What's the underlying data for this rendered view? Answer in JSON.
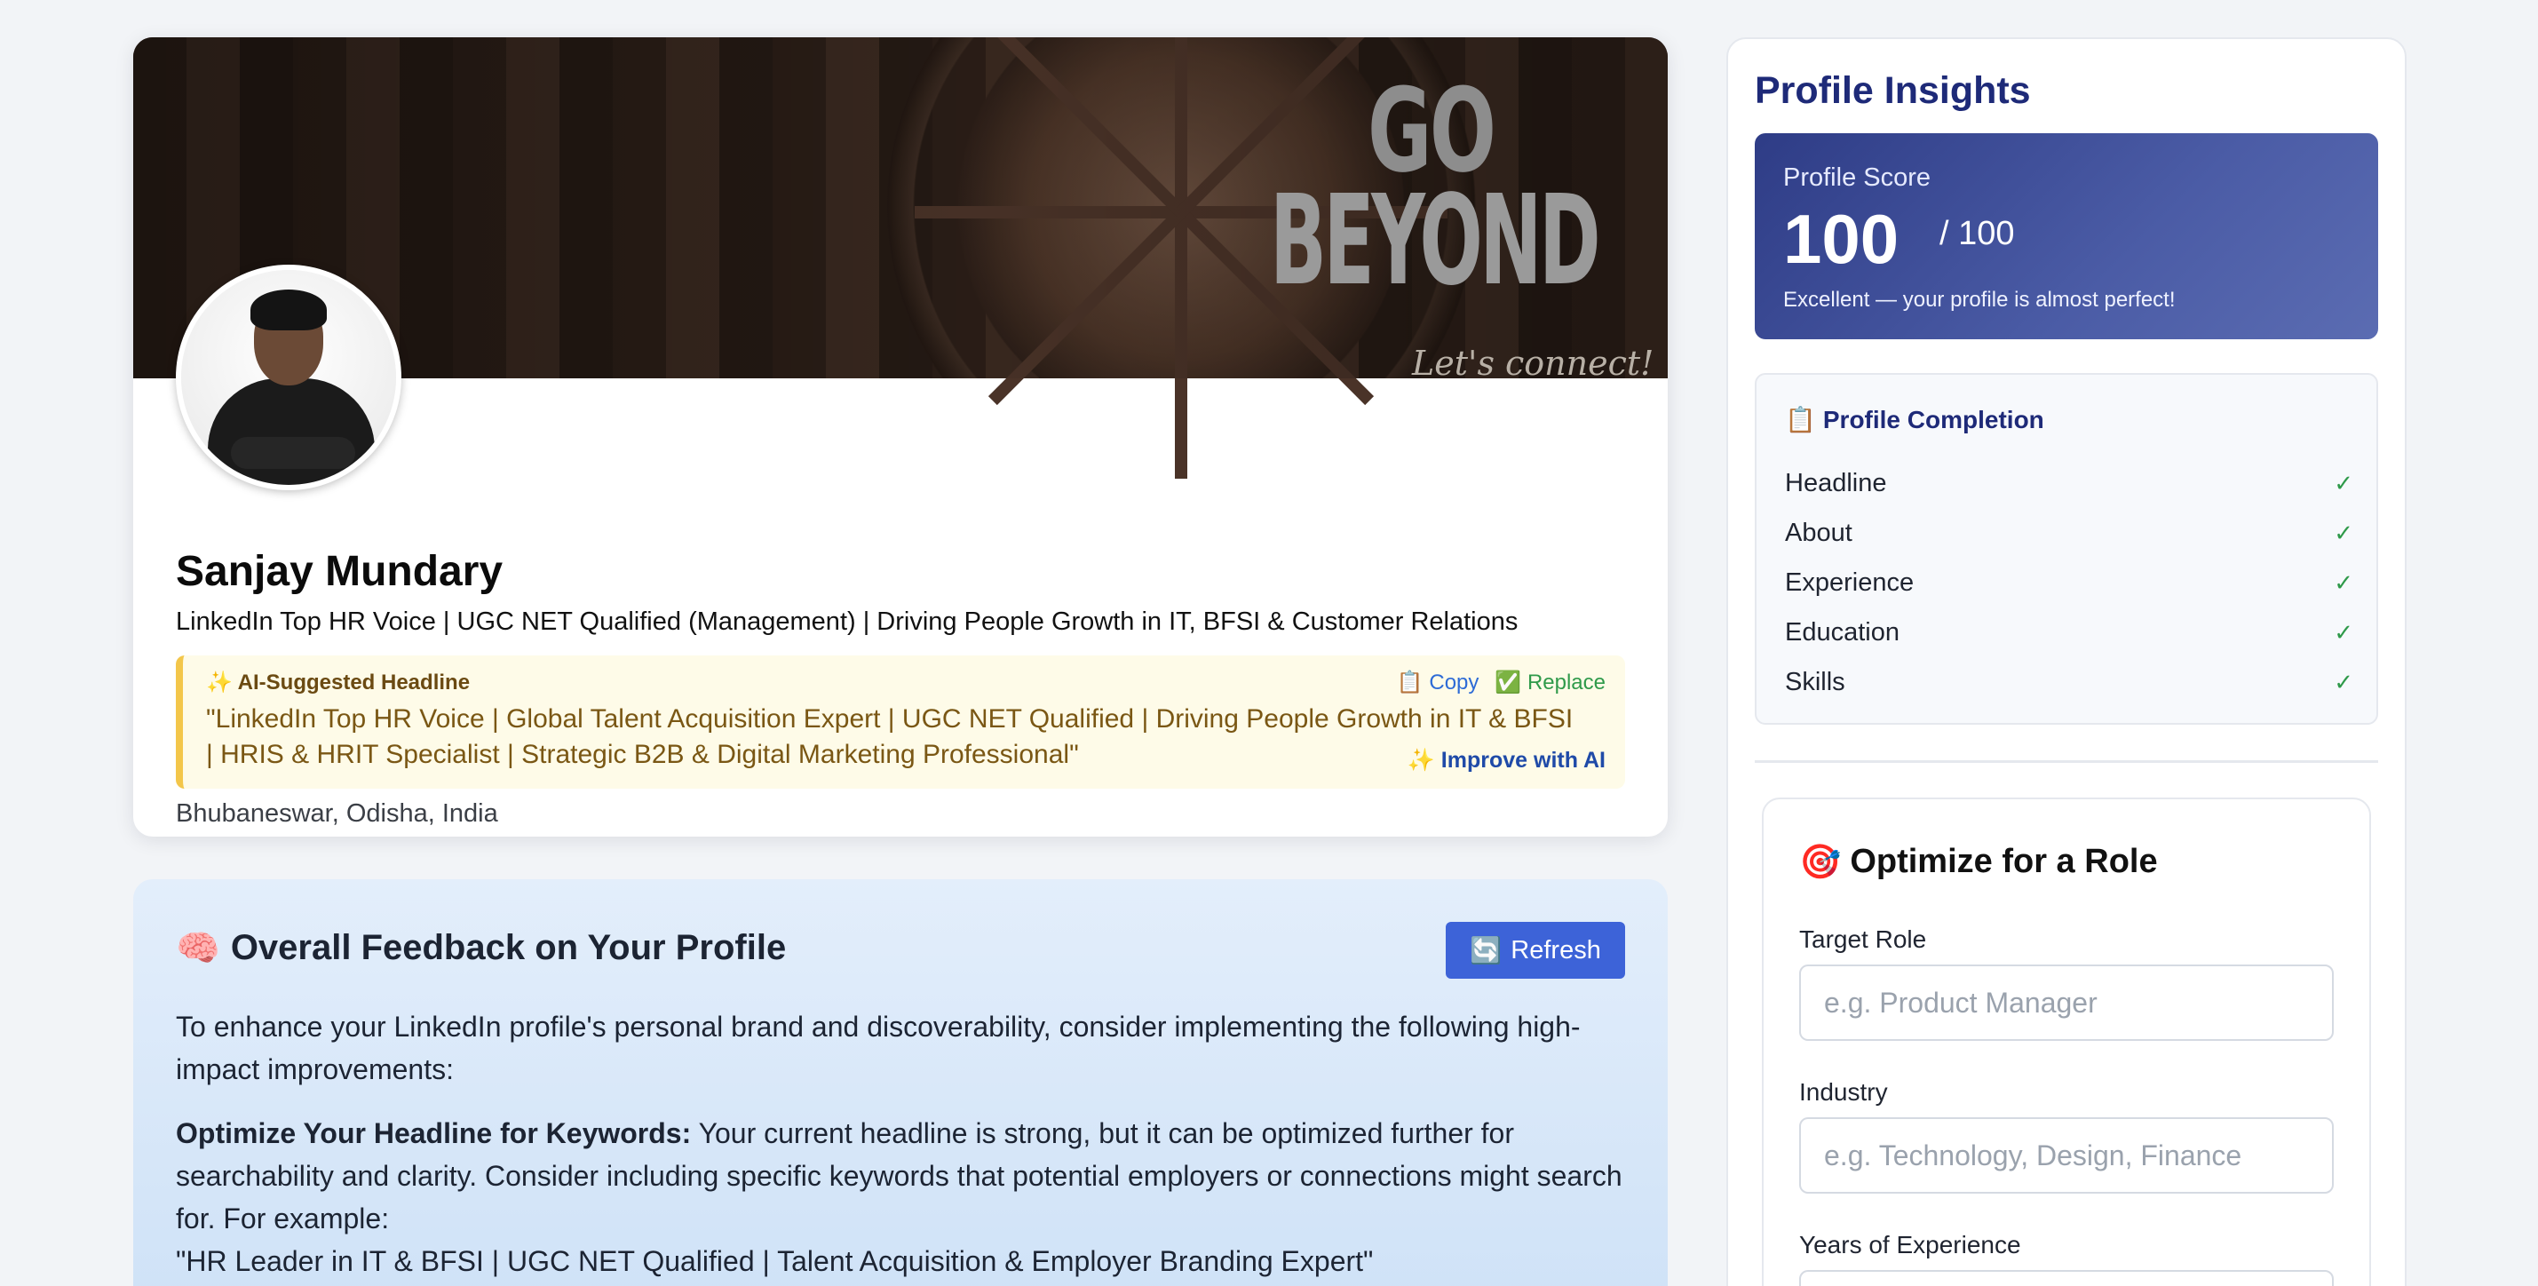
{
  "profile": {
    "banner": {
      "line1": "GO",
      "line2": "BEYOND",
      "tagline": "Let's connect!"
    },
    "name": "Sanjay Mundary",
    "headline": "LinkedIn Top HR Voice | UGC NET Qualified (Management) | Driving People Growth in IT, BFSI & Customer Relations",
    "ai_suggestion": {
      "label": "✨ AI-Suggested Headline",
      "copy_label": "📋 Copy",
      "replace_label": "✅ Replace",
      "text": "\"LinkedIn Top HR Voice | Global Talent Acquisition Expert | UGC NET Qualified | Driving People Growth in IT & BFSI | HRIS & HRIT Specialist | Strategic B2B & Digital Marketing Professional\"",
      "improve_label": "✨ Improve with AI"
    },
    "location": "Bhubaneswar, Odisha, India"
  },
  "feedback": {
    "icon": "🧠",
    "title": "Overall Feedback on Your Profile",
    "refresh_icon": "🔄",
    "refresh_label": "Refresh",
    "intro": "To enhance your LinkedIn profile's personal brand and discoverability, consider implementing the following high-impact improvements:",
    "point1_heading": "Optimize Your Headline for Keywords:",
    "point1_body": " Your current headline is strong, but it can be optimized further for searchability and clarity. Consider including specific keywords that potential employers or connections might search for. For example:",
    "point1_example": "\"HR Leader in IT & BFSI | UGC NET Qualified | Talent Acquisition & Employer Branding Expert\""
  },
  "insights": {
    "title": "Profile Insights",
    "score": {
      "label": "Profile Score",
      "value": "100",
      "max": "/ 100",
      "message": "Excellent — your profile is almost perfect!"
    },
    "completion": {
      "icon": "📋",
      "title": "Profile Completion",
      "items": [
        {
          "label": "Headline",
          "status": "✓"
        },
        {
          "label": "About",
          "status": "✓"
        },
        {
          "label": "Experience",
          "status": "✓"
        },
        {
          "label": "Education",
          "status": "✓"
        },
        {
          "label": "Skills",
          "status": "✓"
        }
      ]
    },
    "optimize": {
      "icon": "🎯",
      "title": "Optimize for a Role",
      "target_role_label": "Target Role",
      "target_role_placeholder": "e.g. Product Manager",
      "industry_label": "Industry",
      "industry_placeholder": "e.g. Technology, Design, Finance",
      "years_label": "Years of Experience"
    }
  },
  "colors": {
    "accent_blue": "#3d63d8",
    "score_gradient_start": "#2e3c86",
    "score_gradient_end": "#5b6cb2",
    "title_navy": "#1e2a78",
    "check_green": "#2f9a4a",
    "ai_box_bg": "#fefbe8",
    "ai_box_border": "#f3c64a"
  }
}
